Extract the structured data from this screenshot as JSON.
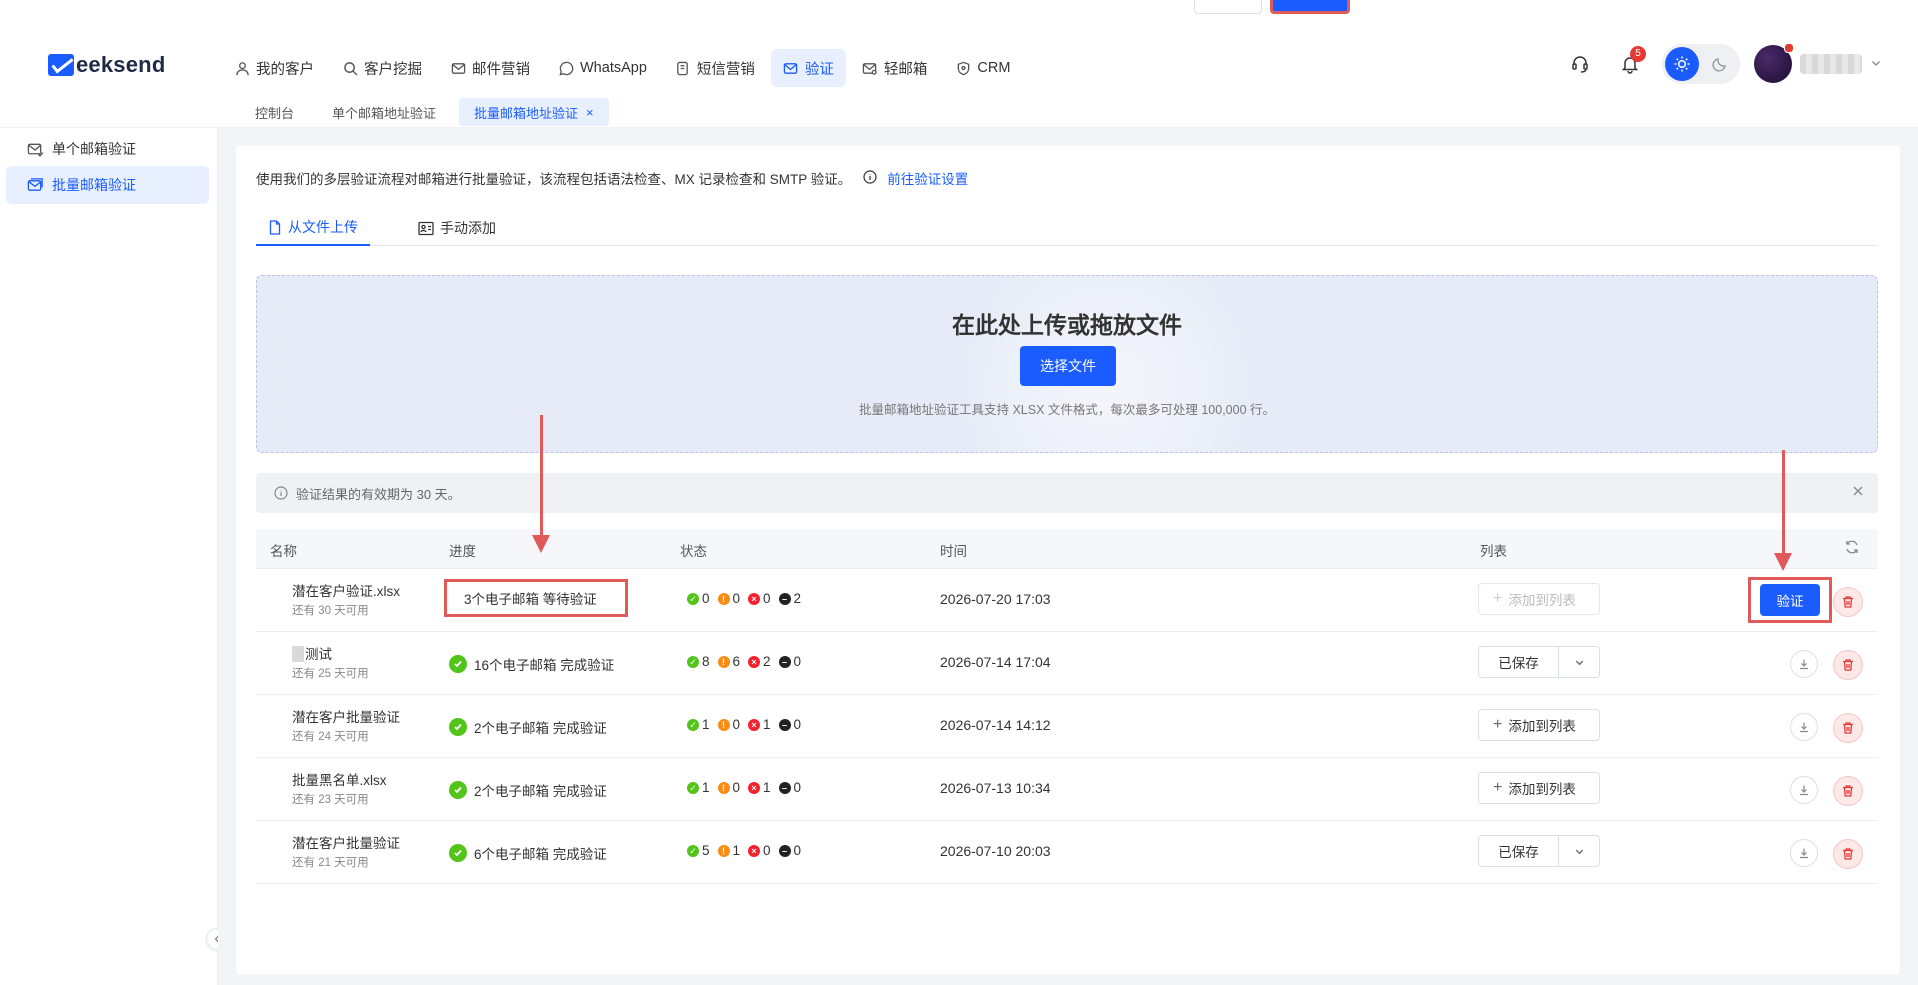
{
  "header": {
    "logo": "eeksend",
    "nav": [
      {
        "label": "我的客户",
        "icon": "user-icon"
      },
      {
        "label": "客户挖掘",
        "icon": "search-icon"
      },
      {
        "label": "邮件营销",
        "icon": "mail-icon"
      },
      {
        "label": "WhatsApp",
        "icon": "whatsapp-icon"
      },
      {
        "label": "短信营销",
        "icon": "sms-icon"
      },
      {
        "label": "验证",
        "icon": "verify-mail-icon",
        "active": true
      },
      {
        "label": "轻邮箱",
        "icon": "light-mail-icon"
      },
      {
        "label": "CRM",
        "icon": "crm-icon"
      }
    ],
    "notification_count": "5",
    "tabs": [
      {
        "label": "控制台"
      },
      {
        "label": "单个邮箱地址验证"
      },
      {
        "label": "批量邮箱地址验证",
        "active": true,
        "close": "×"
      }
    ]
  },
  "sidebar": {
    "items": [
      {
        "label": "单个邮箱验证",
        "icon": "mail-check-icon"
      },
      {
        "label": "批量邮箱验证",
        "icon": "batch-mail-icon",
        "active": true
      }
    ]
  },
  "main": {
    "intro": "使用我们的多层验证流程对邮箱进行批量验证，该流程包括语法检查、MX 记录检查和 SMTP 验证。",
    "intro_link": "前往验证设置",
    "upload_tabs": [
      {
        "label": "从文件上传",
        "active": true
      },
      {
        "label": "手动添加"
      }
    ],
    "dropzone": {
      "title": "在此处上传或拖放文件",
      "button": "选择文件",
      "hint": "批量邮箱地址验证工具支持 XLSX 文件格式，每次最多可处理 100,000 行。"
    },
    "alert": "验证结果的有效期为 30 天。",
    "table": {
      "headers": {
        "name": "名称",
        "progress": "进度",
        "status": "状态",
        "time": "时间",
        "list": "列表"
      },
      "rows": [
        {
          "name": "潜在客户验证.xlsx",
          "sub": "还有 30 天可用",
          "progress": "3个电子邮箱 等待验证",
          "done": false,
          "s_valid": "0",
          "s_risky": "0",
          "s_invalid": "0",
          "s_unknown": "2",
          "time": "2026-07-20 17:03",
          "list_type": "add",
          "list_label": "添加到列表",
          "action": "验证"
        },
        {
          "name": "测试",
          "sub": "还有 25 天可用",
          "progress": "16个电子邮箱 完成验证",
          "done": true,
          "s_valid": "8",
          "s_risky": "6",
          "s_invalid": "2",
          "s_unknown": "0",
          "time": "2026-07-14 17:04",
          "list_type": "saved",
          "list_label": "已保存"
        },
        {
          "name": "潜在客户批量验证",
          "sub": "还有 24 天可用",
          "progress": "2个电子邮箱 完成验证",
          "done": true,
          "s_valid": "1",
          "s_risky": "0",
          "s_invalid": "1",
          "s_unknown": "0",
          "time": "2026-07-14 14:12",
          "list_type": "add",
          "list_label": "添加到列表"
        },
        {
          "name": "批量黑名单.xlsx",
          "sub": "还有 23 天可用",
          "progress": "2个电子邮箱 完成验证",
          "done": true,
          "s_valid": "1",
          "s_risky": "0",
          "s_invalid": "1",
          "s_unknown": "0",
          "time": "2026-07-13 10:34",
          "list_type": "add",
          "list_label": "添加到列表"
        },
        {
          "name": "潜在客户批量验证",
          "sub": "还有 21 天可用",
          "progress": "6个电子邮箱 完成验证",
          "done": true,
          "s_valid": "5",
          "s_risky": "1",
          "s_invalid": "0",
          "s_unknown": "0",
          "time": "2026-07-10 20:03",
          "list_type": "saved",
          "list_label": "已保存"
        }
      ]
    }
  },
  "colors": {
    "accent": "#1a5cff",
    "highlight": "#e05a5a"
  }
}
